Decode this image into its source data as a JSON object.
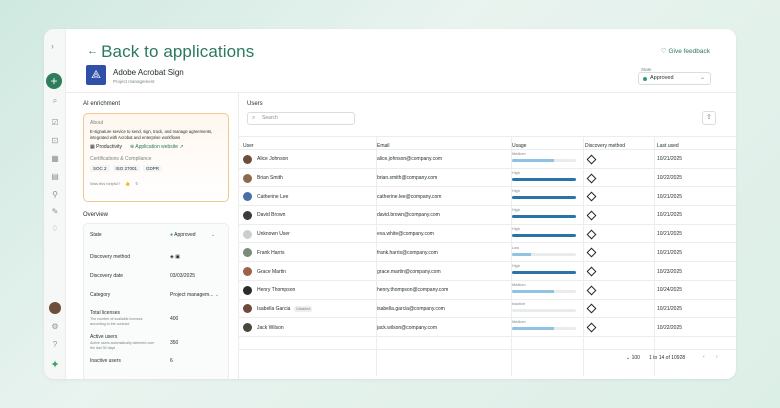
{
  "header": {
    "back_label": "Back to applications",
    "feedback_label": "Give feedback",
    "app_name": "Adobe Acrobat Sign",
    "app_category": "Project management",
    "state_label": "State",
    "state_value": "Approved"
  },
  "ai": {
    "title": "AI enrichment",
    "about_label": "About",
    "description": "E-signature service to send, sign, track, and manage agreements, integrated with Acrobat and enterprise workflows",
    "category_chip": "Productivity",
    "website_link": "Application website",
    "cert_label": "Certifications & Compliance",
    "certs": [
      "SOC 2",
      "ISO 27001",
      "GDPR"
    ],
    "helpful_label": "Was this helpful?"
  },
  "overview": {
    "title": "Overview",
    "rows": [
      {
        "label": "State",
        "value": "Approved",
        "sub": ""
      },
      {
        "label": "Discovery method",
        "value": "",
        "sub": ""
      },
      {
        "label": "Discovery date",
        "value": "03/03/2025",
        "sub": ""
      },
      {
        "label": "Category",
        "value": "Project managem...",
        "sub": ""
      },
      {
        "label": "Total licenses",
        "value": "400",
        "sub": "The number of available licenses according to the contract"
      },
      {
        "label": "Active users",
        "value": "350",
        "sub": "Active users automatically detected over the last 30 days"
      },
      {
        "label": "Inactive users",
        "value": "6",
        "sub": ""
      }
    ]
  },
  "users": {
    "title": "Users",
    "search_placeholder": "Search",
    "columns": [
      "User",
      "Email",
      "Usage",
      "Discovery method",
      "Last used"
    ],
    "rows": [
      {
        "name": "Alice Johnson",
        "tag": "",
        "email": "alice.johnson@company.com",
        "usage_label": "Medium",
        "usage": 0.65,
        "last_used": "10/21/2025",
        "avatar": "#6b4f3a"
      },
      {
        "name": "Brian Smith",
        "tag": "",
        "email": "brian.smith@company.com",
        "usage_label": "High",
        "usage": 1.0,
        "last_used": "10/22/2025",
        "avatar": "#8c6a4e"
      },
      {
        "name": "Catherine Lee",
        "tag": "",
        "email": "catherine.lee@company.com",
        "usage_label": "High",
        "usage": 1.0,
        "last_used": "10/21/2025",
        "avatar": "#4a6fa5"
      },
      {
        "name": "David Brown",
        "tag": "",
        "email": "david.brown@company.com",
        "usage_label": "High",
        "usage": 1.0,
        "last_used": "10/21/2025",
        "avatar": "#3e3a3a"
      },
      {
        "name": "Unknown User",
        "tag": "",
        "email": "eva.white@company.com",
        "usage_label": "High",
        "usage": 1.0,
        "last_used": "10/21/2025",
        "avatar": "#c9cfcf"
      },
      {
        "name": "Frank Harris",
        "tag": "",
        "email": "frank.harris@company.com",
        "usage_label": "Low",
        "usage": 0.3,
        "last_used": "10/21/2025",
        "avatar": "#7c8c7a"
      },
      {
        "name": "Grace Martin",
        "tag": "",
        "email": "grace.martin@company.com",
        "usage_label": "High",
        "usage": 1.0,
        "last_used": "10/23/2025",
        "avatar": "#a0614a"
      },
      {
        "name": "Henry Thompson",
        "tag": "",
        "email": "henry.thompson@company.com",
        "usage_label": "Medium",
        "usage": 0.65,
        "last_used": "10/24/2025",
        "avatar": "#2e2a28"
      },
      {
        "name": "Isabella Garcia",
        "tag": "Disabled",
        "email": "isabella.garcia@company.com",
        "usage_label": "Inactive",
        "usage": 0.0,
        "last_used": "10/21/2025",
        "avatar": "#6e4a3c"
      },
      {
        "name": "Jack Wilson",
        "tag": "",
        "email": "jack.wilson@company.com",
        "usage_label": "Medium",
        "usage": 0.65,
        "last_used": "10/22/2025",
        "avatar": "#4b4540"
      }
    ],
    "page_size": "100",
    "pagination": "1 to 14 of 10928"
  }
}
